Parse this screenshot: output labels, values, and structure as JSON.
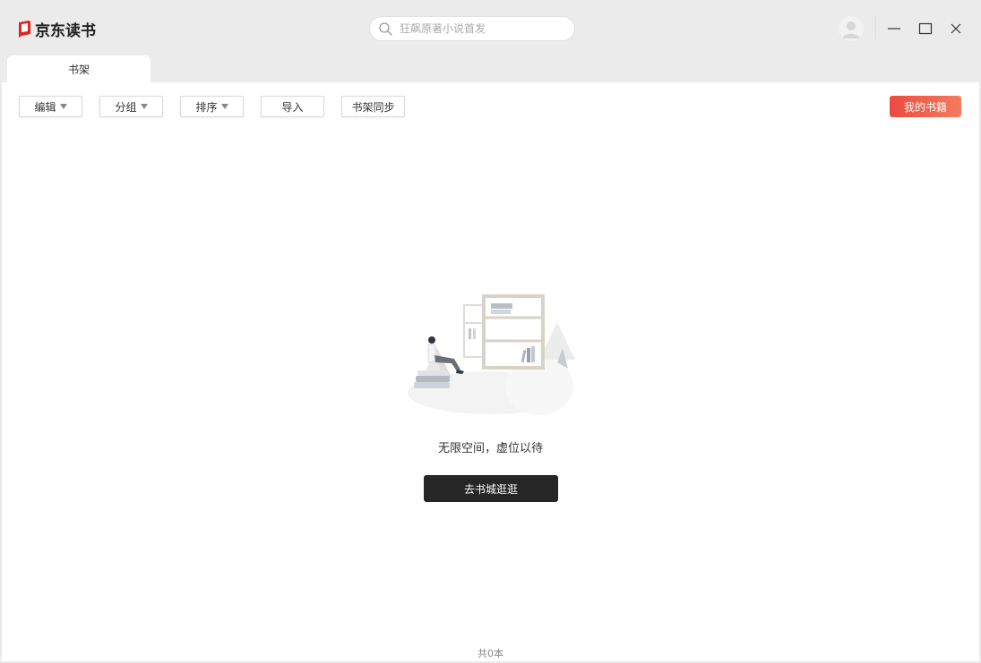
{
  "app": {
    "logo_text": "京东读书",
    "brand_color": "#e1251b"
  },
  "search": {
    "placeholder": "狂飙原著小说首发",
    "icon": "search-icon"
  },
  "window_controls": {
    "minimize": "minimize-icon",
    "maximize": "maximize-icon",
    "close": "close-icon"
  },
  "tabs": [
    {
      "label": "书架"
    }
  ],
  "toolbar": {
    "edit_label": "编辑",
    "group_label": "分组",
    "sort_label": "排序",
    "import_label": "导入",
    "sync_label": "书架同步",
    "my_books_label": "我的书籍"
  },
  "empty": {
    "message": "无限空间，虚位以待",
    "button_label": "去书城逛逛"
  },
  "footer": {
    "count_text": "共0本"
  },
  "colors": {
    "accent_start": "#ec4b3f",
    "accent_end": "#f47c5c",
    "dark_button": "#262626"
  }
}
